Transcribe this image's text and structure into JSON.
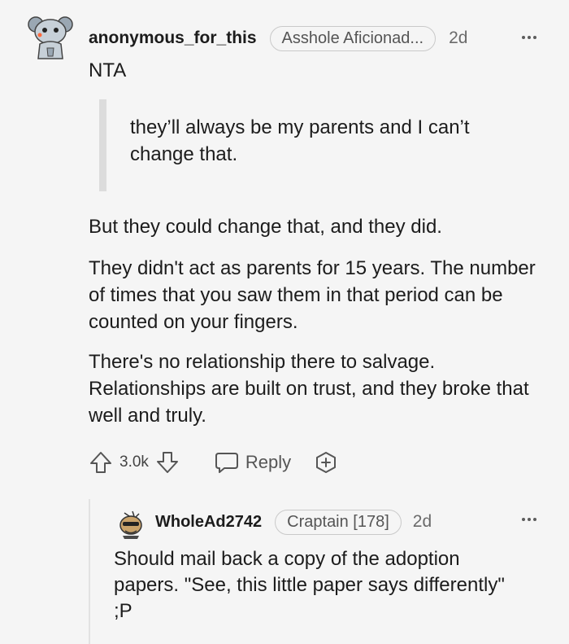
{
  "comment": {
    "username": "anonymous_for_this",
    "flair": "Asshole Aficionad...",
    "time": "2d",
    "verdict": "NTA",
    "quote": "they’ll always be my parents and I can’t change that.",
    "paragraphs": [
      "But they could change that, and they did.",
      "They didn't act as parents for 15 years. The number of times that you saw them in that period can be counted on your fingers.",
      "There's no relationship there to salvage. Relationships are built on trust, and they broke that well and truly."
    ],
    "votes": "3.0k",
    "reply_label": "Reply"
  },
  "reply": {
    "username": "WholeAd2742",
    "flair": "Craptain [178]",
    "time": "2d",
    "body": "Should mail back a copy of the adoption papers. \"See, this little paper says differently\" ;P"
  },
  "colors": {
    "background": "#f5f5f5",
    "text": "#1c1c1c",
    "muted": "#6a6a6a",
    "quote_bar": "#dcdcdc",
    "flair_border": "#c9c9c9"
  },
  "icons": [
    "snoo-avatar-icon",
    "ellipsis-icon",
    "upvote-arrow-icon",
    "downvote-arrow-icon",
    "reply-bubble-icon",
    "award-plus-icon",
    "user-avatar-icon"
  ]
}
